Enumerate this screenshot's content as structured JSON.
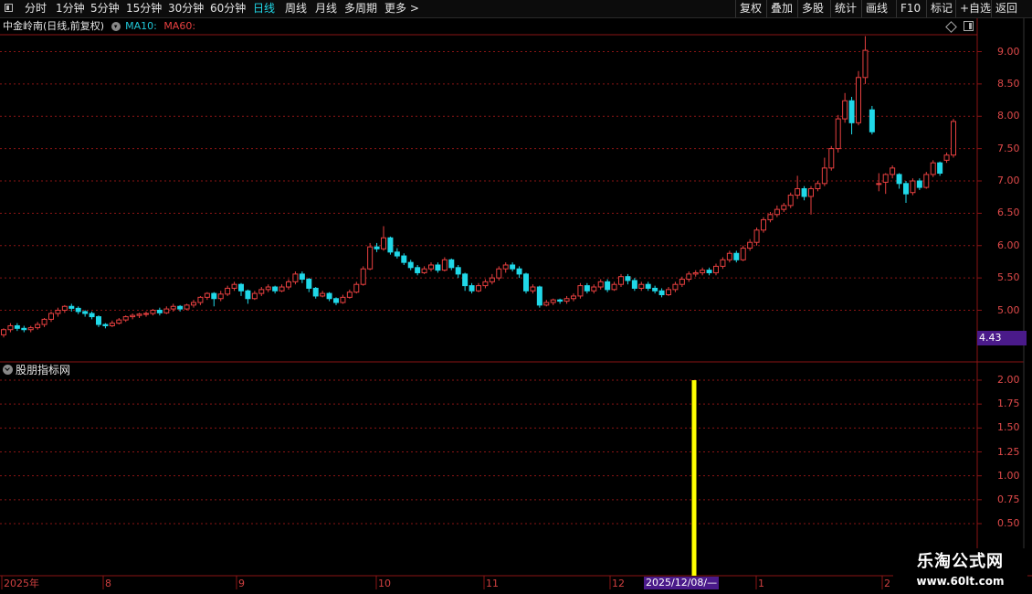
{
  "toolbar": {
    "left_items": [
      "分时",
      "1分钟",
      "5分钟",
      "15分钟",
      "30分钟",
      "60分钟",
      "日线",
      "周线",
      "月线",
      "多周期",
      "更多 >"
    ],
    "active": "日线",
    "right_items": [
      "复权",
      "叠加",
      "多股",
      "统计",
      "画线",
      "F10",
      "标记",
      "+自选",
      "返回"
    ]
  },
  "header": {
    "stock_title": "中金岭南(日线,前复权)",
    "ma10_label": "MA10:",
    "ma60_label": "MA60:"
  },
  "price_axis": {
    "ticks": [
      "9.00",
      "8.50",
      "8.00",
      "7.50",
      "7.00",
      "6.50",
      "6.00",
      "5.50",
      "5.00"
    ],
    "current_price": "4.43"
  },
  "indicator": {
    "name": "股朋指标网",
    "ticks": [
      "2.00",
      "1.75",
      "1.50",
      "1.25",
      "1.00",
      "0.75",
      "0.50"
    ],
    "signal_value": 2.0,
    "signal_date": "2025/12/08"
  },
  "time_axis": {
    "labels": [
      "2025年",
      "8",
      "9",
      "10",
      "11",
      "12",
      "1",
      "2"
    ],
    "cursor_label": "2025/12/08/—"
  },
  "watermark": {
    "title": "乐淘公式网",
    "url": "www.60lt.com"
  },
  "colors": {
    "up": "#e84040",
    "down": "#20d8e8",
    "signal": "#ffff00",
    "grid": "#8a1515"
  },
  "chart_data": {
    "type": "candlestick",
    "ylim": [
      4.6,
      9.3
    ],
    "candles": [
      [
        4.62,
        4.7,
        4.58,
        4.72
      ],
      [
        4.7,
        4.76,
        4.66,
        4.8
      ],
      [
        4.76,
        4.72,
        4.68,
        4.8
      ],
      [
        4.72,
        4.7,
        4.66,
        4.76
      ],
      [
        4.7,
        4.73,
        4.66,
        4.76
      ],
      [
        4.73,
        4.78,
        4.7,
        4.82
      ],
      [
        4.78,
        4.86,
        4.74,
        4.88
      ],
      [
        4.86,
        4.95,
        4.82,
        4.98
      ],
      [
        4.95,
        5.0,
        4.9,
        5.04
      ],
      [
        5.0,
        5.06,
        4.96,
        5.08
      ],
      [
        5.06,
        5.03,
        4.98,
        5.1
      ],
      [
        5.03,
        4.98,
        4.94,
        5.06
      ],
      [
        4.98,
        4.95,
        4.9,
        5.0
      ],
      [
        4.95,
        4.9,
        4.86,
        4.98
      ],
      [
        4.9,
        4.78,
        4.74,
        4.92
      ],
      [
        4.78,
        4.76,
        4.72,
        4.8
      ],
      [
        4.76,
        4.8,
        4.74,
        4.84
      ],
      [
        4.8,
        4.85,
        4.78,
        4.88
      ],
      [
        4.85,
        4.9,
        4.82,
        4.92
      ],
      [
        4.9,
        4.92,
        4.86,
        4.95
      ],
      [
        4.92,
        4.94,
        4.88,
        4.96
      ],
      [
        4.94,
        4.95,
        4.9,
        4.98
      ],
      [
        4.95,
        5.0,
        4.92,
        5.02
      ],
      [
        5.0,
        4.96,
        4.92,
        5.04
      ],
      [
        4.96,
        5.02,
        4.94,
        5.06
      ],
      [
        5.02,
        5.06,
        4.98,
        5.1
      ],
      [
        5.06,
        5.02,
        4.98,
        5.08
      ],
      [
        5.02,
        5.08,
        5.0,
        5.1
      ],
      [
        5.08,
        5.12,
        5.04,
        5.16
      ],
      [
        5.12,
        5.2,
        5.08,
        5.22
      ],
      [
        5.2,
        5.26,
        5.16,
        5.28
      ],
      [
        5.26,
        5.18,
        5.06,
        5.28
      ],
      [
        5.18,
        5.25,
        5.14,
        5.3
      ],
      [
        5.25,
        5.34,
        5.22,
        5.38
      ],
      [
        5.34,
        5.4,
        5.3,
        5.44
      ],
      [
        5.4,
        5.3,
        5.22,
        5.42
      ],
      [
        5.3,
        5.18,
        5.1,
        5.32
      ],
      [
        5.18,
        5.26,
        5.16,
        5.3
      ],
      [
        5.26,
        5.32,
        5.22,
        5.36
      ],
      [
        5.32,
        5.36,
        5.28,
        5.4
      ],
      [
        5.36,
        5.3,
        5.26,
        5.38
      ],
      [
        5.3,
        5.36,
        5.28,
        5.4
      ],
      [
        5.36,
        5.44,
        5.32,
        5.48
      ],
      [
        5.44,
        5.56,
        5.4,
        5.6
      ],
      [
        5.56,
        5.48,
        5.42,
        5.6
      ],
      [
        5.48,
        5.34,
        5.28,
        5.5
      ],
      [
        5.34,
        5.22,
        5.18,
        5.36
      ],
      [
        5.22,
        5.26,
        5.2,
        5.3
      ],
      [
        5.26,
        5.18,
        5.14,
        5.28
      ],
      [
        5.18,
        5.12,
        5.08,
        5.2
      ],
      [
        5.12,
        5.2,
        5.1,
        5.24
      ],
      [
        5.2,
        5.28,
        5.18,
        5.32
      ],
      [
        5.28,
        5.4,
        5.26,
        5.44
      ],
      [
        5.4,
        5.64,
        5.38,
        5.68
      ],
      [
        5.64,
        5.98,
        5.62,
        6.04
      ],
      [
        5.98,
        5.95,
        5.9,
        6.04
      ],
      [
        5.95,
        6.12,
        5.92,
        6.3
      ],
      [
        6.12,
        5.9,
        5.86,
        6.14
      ],
      [
        5.9,
        5.84,
        5.8,
        5.96
      ],
      [
        5.84,
        5.74,
        5.7,
        5.88
      ],
      [
        5.74,
        5.66,
        5.62,
        5.78
      ],
      [
        5.66,
        5.58,
        5.54,
        5.7
      ],
      [
        5.58,
        5.64,
        5.56,
        5.68
      ],
      [
        5.64,
        5.7,
        5.6,
        5.74
      ],
      [
        5.7,
        5.62,
        5.58,
        5.74
      ],
      [
        5.62,
        5.78,
        5.6,
        5.82
      ],
      [
        5.78,
        5.66,
        5.62,
        5.8
      ],
      [
        5.66,
        5.56,
        5.5,
        5.7
      ],
      [
        5.56,
        5.38,
        5.3,
        5.58
      ],
      [
        5.38,
        5.3,
        5.26,
        5.42
      ],
      [
        5.3,
        5.38,
        5.28,
        5.42
      ],
      [
        5.38,
        5.44,
        5.34,
        5.48
      ],
      [
        5.44,
        5.5,
        5.4,
        5.56
      ],
      [
        5.5,
        5.64,
        5.46,
        5.68
      ],
      [
        5.64,
        5.7,
        5.58,
        5.74
      ],
      [
        5.7,
        5.64,
        5.6,
        5.74
      ],
      [
        5.64,
        5.56,
        5.5,
        5.68
      ],
      [
        5.56,
        5.3,
        5.26,
        5.58
      ],
      [
        5.3,
        5.36,
        5.26,
        5.4
      ],
      [
        5.36,
        5.08,
        5.04,
        5.38
      ],
      [
        5.08,
        5.12,
        5.06,
        5.16
      ],
      [
        5.12,
        5.16,
        5.08,
        5.18
      ],
      [
        5.16,
        5.14,
        5.1,
        5.18
      ],
      [
        5.14,
        5.18,
        5.1,
        5.22
      ],
      [
        5.18,
        5.22,
        5.14,
        5.26
      ],
      [
        5.22,
        5.38,
        5.18,
        5.42
      ],
      [
        5.38,
        5.3,
        5.26,
        5.42
      ],
      [
        5.3,
        5.36,
        5.26,
        5.4
      ],
      [
        5.36,
        5.44,
        5.32,
        5.48
      ],
      [
        5.44,
        5.32,
        5.28,
        5.48
      ],
      [
        5.32,
        5.4,
        5.3,
        5.44
      ],
      [
        5.4,
        5.52,
        5.36,
        5.56
      ],
      [
        5.52,
        5.46,
        5.4,
        5.56
      ],
      [
        5.46,
        5.34,
        5.3,
        5.5
      ],
      [
        5.34,
        5.4,
        5.3,
        5.44
      ],
      [
        5.4,
        5.34,
        5.3,
        5.44
      ],
      [
        5.34,
        5.3,
        5.26,
        5.38
      ],
      [
        5.3,
        5.24,
        5.2,
        5.34
      ],
      [
        5.24,
        5.32,
        5.22,
        5.36
      ],
      [
        5.32,
        5.4,
        5.28,
        5.44
      ],
      [
        5.4,
        5.48,
        5.36,
        5.52
      ],
      [
        5.48,
        5.56,
        5.44,
        5.6
      ],
      [
        5.56,
        5.58,
        5.52,
        5.62
      ],
      [
        5.58,
        5.62,
        5.54,
        5.66
      ],
      [
        5.62,
        5.58,
        5.54,
        5.66
      ],
      [
        5.58,
        5.68,
        5.54,
        5.72
      ],
      [
        5.68,
        5.78,
        5.64,
        5.82
      ],
      [
        5.78,
        5.88,
        5.74,
        5.92
      ],
      [
        5.88,
        5.78,
        5.74,
        5.92
      ],
      [
        5.78,
        5.96,
        5.76,
        6.0
      ],
      [
        5.96,
        6.05,
        5.92,
        6.1
      ],
      [
        6.05,
        6.24,
        6.0,
        6.28
      ],
      [
        6.24,
        6.4,
        6.2,
        6.44
      ],
      [
        6.4,
        6.48,
        6.36,
        6.52
      ],
      [
        6.48,
        6.56,
        6.44,
        6.62
      ],
      [
        6.56,
        6.62,
        6.52,
        6.66
      ],
      [
        6.62,
        6.78,
        6.58,
        6.82
      ],
      [
        6.78,
        6.88,
        6.72,
        7.08
      ],
      [
        6.88,
        6.76,
        6.7,
        6.92
      ],
      [
        6.76,
        6.88,
        6.48,
        6.92
      ],
      [
        6.88,
        6.96,
        6.84,
        7.0
      ],
      [
        6.96,
        7.2,
        6.92,
        7.36
      ],
      [
        7.2,
        7.5,
        7.16,
        7.54
      ],
      [
        7.5,
        7.96,
        7.44,
        8.02
      ],
      [
        7.96,
        8.24,
        7.9,
        8.36
      ],
      [
        8.24,
        7.9,
        7.72,
        8.3
      ],
      [
        7.9,
        8.6,
        7.86,
        8.7
      ],
      [
        8.6,
        9.02,
        8.5,
        9.24
      ],
      [
        8.1,
        7.76,
        7.72,
        8.16
      ],
      [
        6.96,
        6.96,
        6.84,
        7.12
      ],
      [
        6.98,
        7.1,
        6.8,
        7.12
      ],
      [
        7.1,
        7.2,
        7.04,
        7.24
      ],
      [
        7.1,
        6.96,
        6.88,
        7.12
      ],
      [
        6.96,
        6.8,
        6.66,
        7.0
      ],
      [
        6.82,
        7.0,
        6.78,
        7.04
      ],
      [
        7.0,
        6.9,
        6.86,
        7.04
      ],
      [
        6.9,
        7.1,
        6.88,
        7.14
      ],
      [
        7.1,
        7.28,
        7.06,
        7.32
      ],
      [
        7.28,
        7.12,
        7.08,
        7.3
      ],
      [
        7.32,
        7.4,
        7.28,
        7.44
      ],
      [
        7.4,
        7.92,
        7.36,
        7.96
      ]
    ]
  }
}
